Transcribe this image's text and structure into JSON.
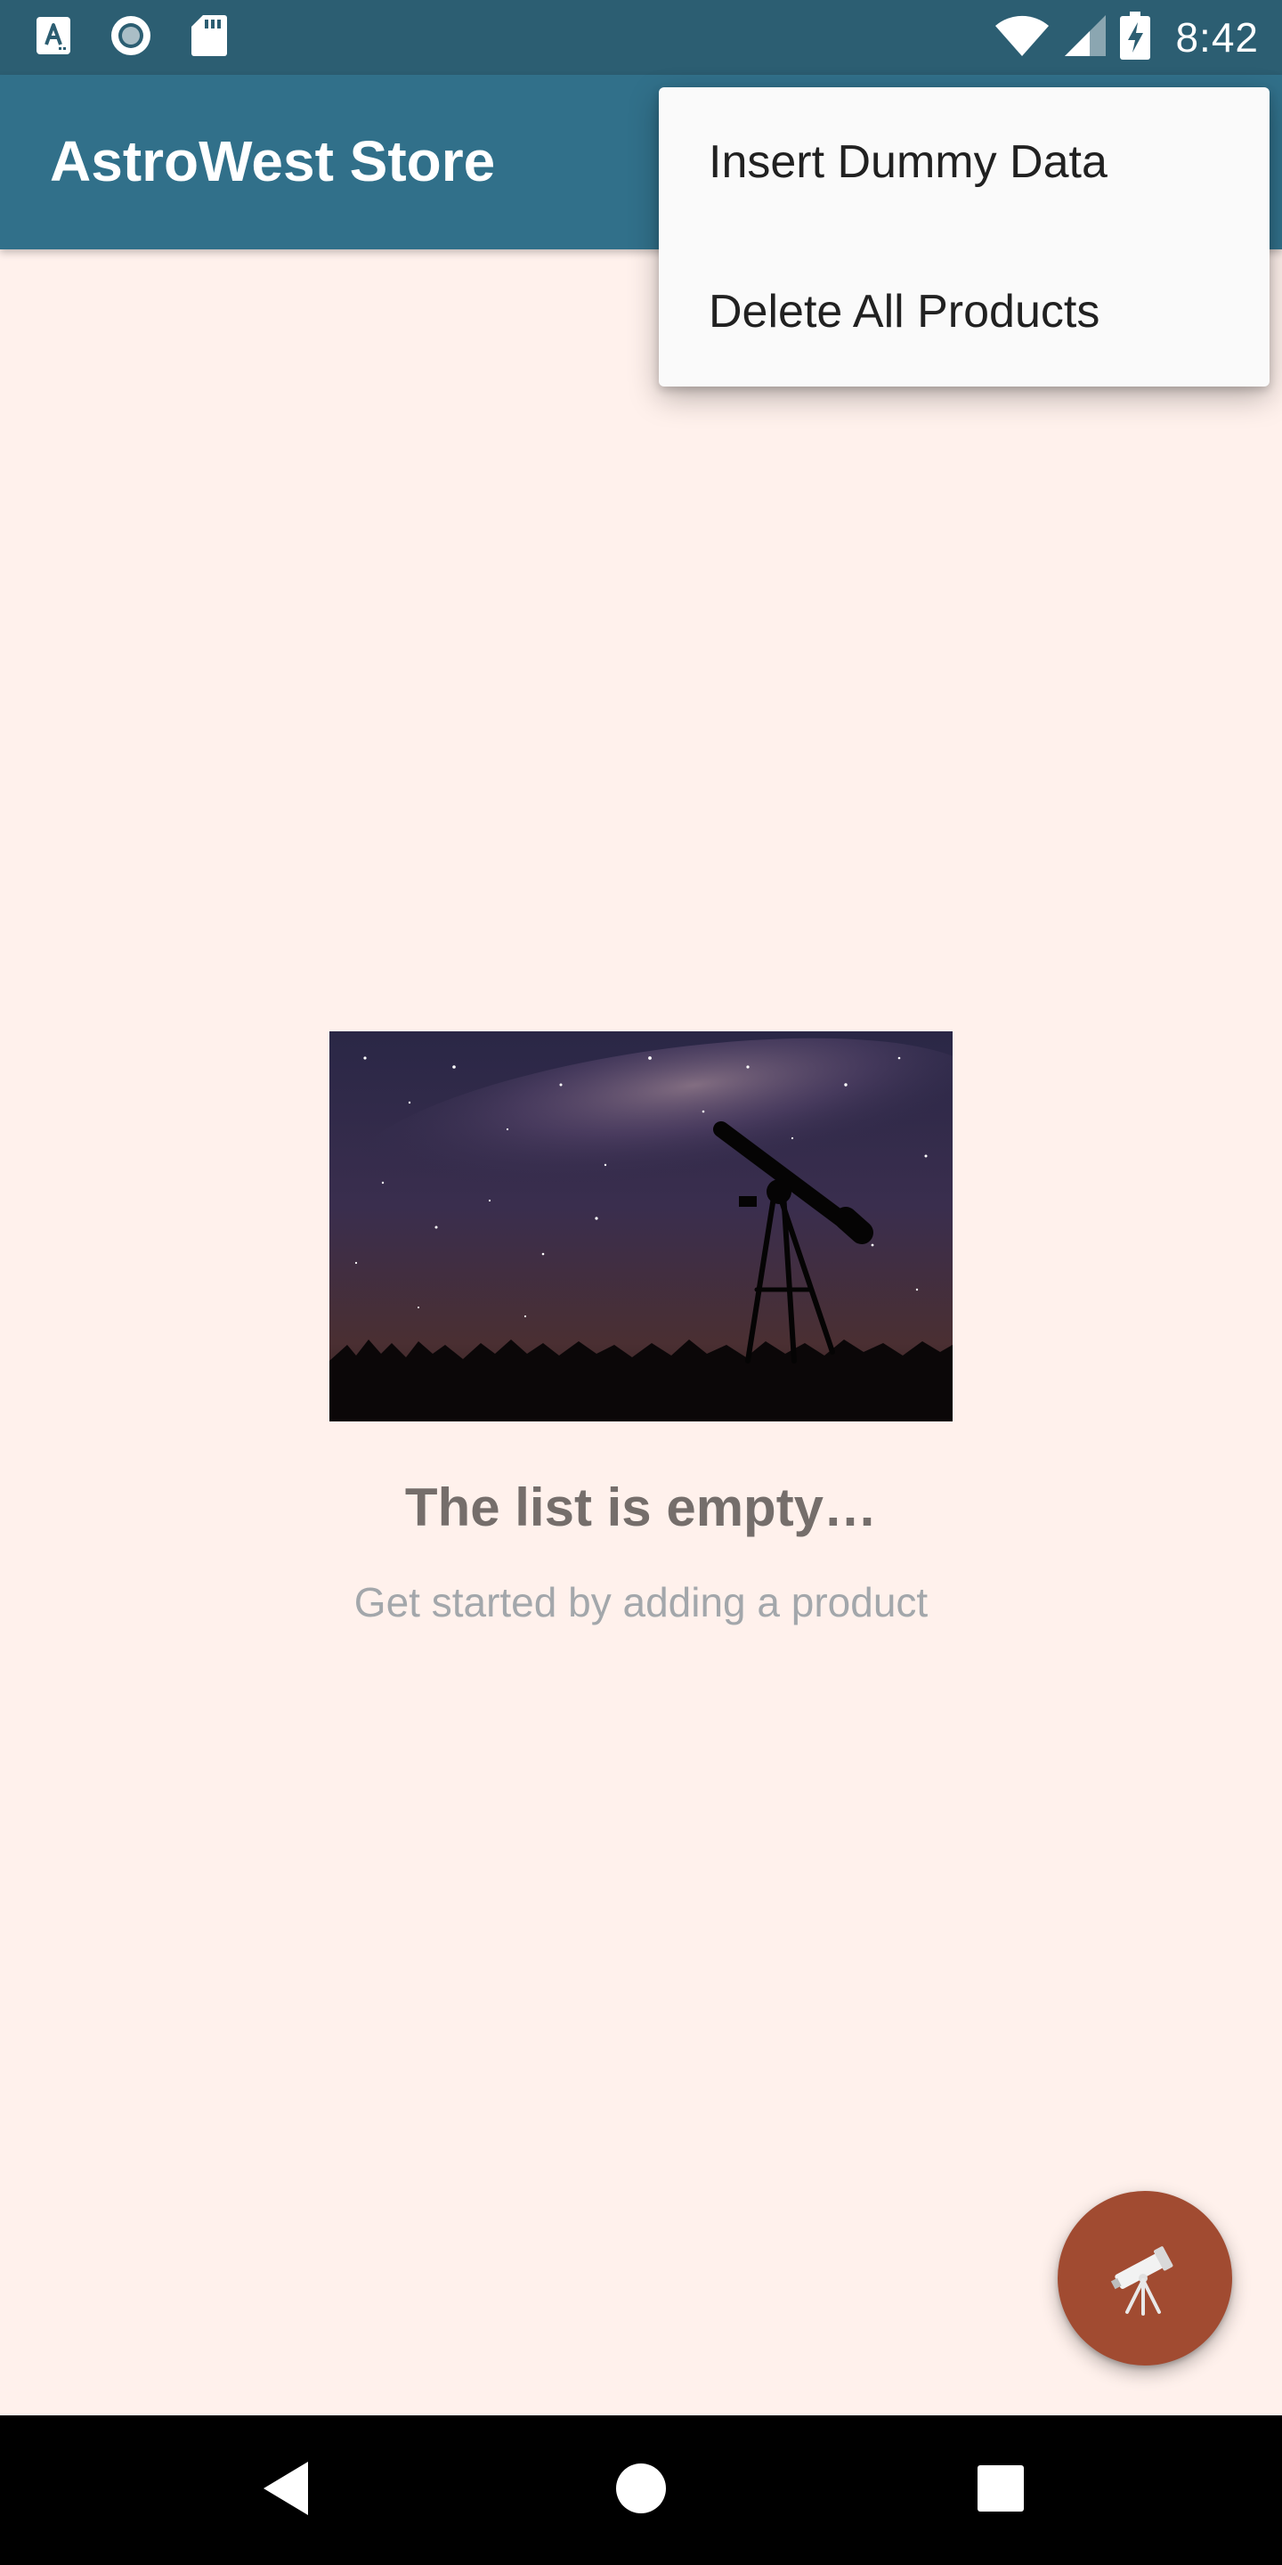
{
  "status_bar": {
    "time": "8:42",
    "left_icons": [
      "font-download-icon",
      "radio-button-icon",
      "sd-card-icon"
    ],
    "right_icons": [
      "wifi-icon",
      "cellular-signal-icon",
      "battery-charging-icon"
    ]
  },
  "app_bar": {
    "title": "AstroWest Store",
    "color": "#31708A"
  },
  "menu": {
    "items": [
      {
        "label": "Insert Dummy Data"
      },
      {
        "label": "Delete All Products"
      }
    ]
  },
  "empty_state": {
    "image": "night-sky-telescope-image",
    "title": "The list is empty…",
    "subtitle": "Get started by adding a product"
  },
  "fab": {
    "icon": "telescope-icon",
    "color": "#A14B31"
  },
  "nav_bar": {
    "buttons": [
      "back-icon",
      "home-icon",
      "recents-icon"
    ]
  }
}
